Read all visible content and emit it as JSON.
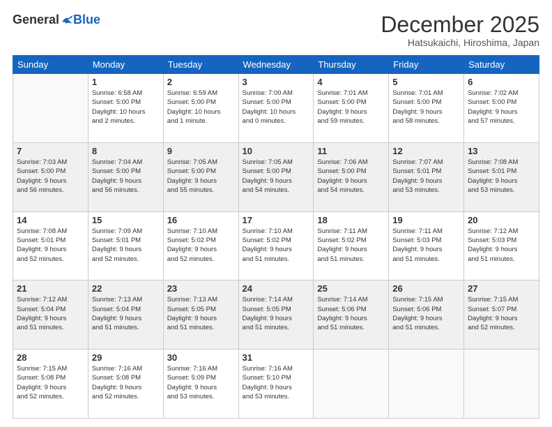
{
  "header": {
    "logo_general": "General",
    "logo_blue": "Blue",
    "month": "December 2025",
    "location": "Hatsukaichi, Hiroshima, Japan"
  },
  "days_of_week": [
    "Sunday",
    "Monday",
    "Tuesday",
    "Wednesday",
    "Thursday",
    "Friday",
    "Saturday"
  ],
  "weeks": [
    [
      {
        "day": "",
        "info": ""
      },
      {
        "day": "1",
        "info": "Sunrise: 6:58 AM\nSunset: 5:00 PM\nDaylight: 10 hours\nand 2 minutes."
      },
      {
        "day": "2",
        "info": "Sunrise: 6:59 AM\nSunset: 5:00 PM\nDaylight: 10 hours\nand 1 minute."
      },
      {
        "day": "3",
        "info": "Sunrise: 7:00 AM\nSunset: 5:00 PM\nDaylight: 10 hours\nand 0 minutes."
      },
      {
        "day": "4",
        "info": "Sunrise: 7:01 AM\nSunset: 5:00 PM\nDaylight: 9 hours\nand 59 minutes."
      },
      {
        "day": "5",
        "info": "Sunrise: 7:01 AM\nSunset: 5:00 PM\nDaylight: 9 hours\nand 58 minutes."
      },
      {
        "day": "6",
        "info": "Sunrise: 7:02 AM\nSunset: 5:00 PM\nDaylight: 9 hours\nand 57 minutes."
      }
    ],
    [
      {
        "day": "7",
        "info": "Sunrise: 7:03 AM\nSunset: 5:00 PM\nDaylight: 9 hours\nand 56 minutes."
      },
      {
        "day": "8",
        "info": "Sunrise: 7:04 AM\nSunset: 5:00 PM\nDaylight: 9 hours\nand 56 minutes."
      },
      {
        "day": "9",
        "info": "Sunrise: 7:05 AM\nSunset: 5:00 PM\nDaylight: 9 hours\nand 55 minutes."
      },
      {
        "day": "10",
        "info": "Sunrise: 7:05 AM\nSunset: 5:00 PM\nDaylight: 9 hours\nand 54 minutes."
      },
      {
        "day": "11",
        "info": "Sunrise: 7:06 AM\nSunset: 5:00 PM\nDaylight: 9 hours\nand 54 minutes."
      },
      {
        "day": "12",
        "info": "Sunrise: 7:07 AM\nSunset: 5:01 PM\nDaylight: 9 hours\nand 53 minutes."
      },
      {
        "day": "13",
        "info": "Sunrise: 7:08 AM\nSunset: 5:01 PM\nDaylight: 9 hours\nand 53 minutes."
      }
    ],
    [
      {
        "day": "14",
        "info": "Sunrise: 7:08 AM\nSunset: 5:01 PM\nDaylight: 9 hours\nand 52 minutes."
      },
      {
        "day": "15",
        "info": "Sunrise: 7:09 AM\nSunset: 5:01 PM\nDaylight: 9 hours\nand 52 minutes."
      },
      {
        "day": "16",
        "info": "Sunrise: 7:10 AM\nSunset: 5:02 PM\nDaylight: 9 hours\nand 52 minutes."
      },
      {
        "day": "17",
        "info": "Sunrise: 7:10 AM\nSunset: 5:02 PM\nDaylight: 9 hours\nand 51 minutes."
      },
      {
        "day": "18",
        "info": "Sunrise: 7:11 AM\nSunset: 5:02 PM\nDaylight: 9 hours\nand 51 minutes."
      },
      {
        "day": "19",
        "info": "Sunrise: 7:11 AM\nSunset: 5:03 PM\nDaylight: 9 hours\nand 51 minutes."
      },
      {
        "day": "20",
        "info": "Sunrise: 7:12 AM\nSunset: 5:03 PM\nDaylight: 9 hours\nand 51 minutes."
      }
    ],
    [
      {
        "day": "21",
        "info": "Sunrise: 7:12 AM\nSunset: 5:04 PM\nDaylight: 9 hours\nand 51 minutes."
      },
      {
        "day": "22",
        "info": "Sunrise: 7:13 AM\nSunset: 5:04 PM\nDaylight: 9 hours\nand 51 minutes."
      },
      {
        "day": "23",
        "info": "Sunrise: 7:13 AM\nSunset: 5:05 PM\nDaylight: 9 hours\nand 51 minutes."
      },
      {
        "day": "24",
        "info": "Sunrise: 7:14 AM\nSunset: 5:05 PM\nDaylight: 9 hours\nand 51 minutes."
      },
      {
        "day": "25",
        "info": "Sunrise: 7:14 AM\nSunset: 5:06 PM\nDaylight: 9 hours\nand 51 minutes."
      },
      {
        "day": "26",
        "info": "Sunrise: 7:15 AM\nSunset: 5:06 PM\nDaylight: 9 hours\nand 51 minutes."
      },
      {
        "day": "27",
        "info": "Sunrise: 7:15 AM\nSunset: 5:07 PM\nDaylight: 9 hours\nand 52 minutes."
      }
    ],
    [
      {
        "day": "28",
        "info": "Sunrise: 7:15 AM\nSunset: 5:08 PM\nDaylight: 9 hours\nand 52 minutes."
      },
      {
        "day": "29",
        "info": "Sunrise: 7:16 AM\nSunset: 5:08 PM\nDaylight: 9 hours\nand 52 minutes."
      },
      {
        "day": "30",
        "info": "Sunrise: 7:16 AM\nSunset: 5:09 PM\nDaylight: 9 hours\nand 53 minutes."
      },
      {
        "day": "31",
        "info": "Sunrise: 7:16 AM\nSunset: 5:10 PM\nDaylight: 9 hours\nand 53 minutes."
      },
      {
        "day": "",
        "info": ""
      },
      {
        "day": "",
        "info": ""
      },
      {
        "day": "",
        "info": ""
      }
    ]
  ]
}
